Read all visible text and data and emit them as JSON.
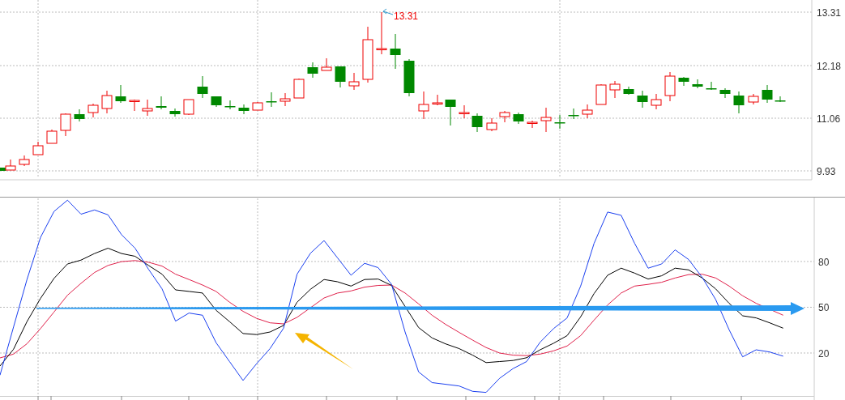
{
  "price_panel": {
    "axis_labels": [
      "13.31",
      "12.18",
      "11.06",
      "9.93"
    ],
    "high_marker": "13.31"
  },
  "indicator_panel": {
    "chart_data": {
      "type": "line",
      "ylim": [
        -10.8,
        121.9
      ],
      "grid": true,
      "yticks": [
        20,
        50,
        80
      ],
      "series": [
        {
          "color": "#e0204a",
          "values": [
            16.8,
            19.3,
            26.1,
            36,
            46.9,
            57.9,
            65.7,
            72.8,
            77.4,
            79.9,
            80.6,
            79.5,
            77,
            71.7,
            68.2,
            64.6,
            60.4,
            53.3,
            47.3,
            42.7,
            39.8,
            39.1,
            43.4,
            null,
            56.1,
            59.3,
            60.7,
            63.2,
            64.3,
            64.6,
            59.3,
            52.2,
            44.8,
            38.8,
            33.5,
            28.5,
            23.6,
            20,
            18.6,
            18.3,
            19.3,
            21.4,
            24.6,
            31.4,
            41.6,
            51.5,
            59.3,
            63.9,
            65,
            66.4,
            69.2,
            71.4,
            71.7,
            69.2,
            63.9,
            57.5,
            52.6,
            null,
            44.8
          ]
        },
        {
          "color": "#000000",
          "values": [
            11.5,
            22.5,
            40.6,
            55.8,
            68.9,
            78.4,
            80.9,
            85.2,
            88.7,
            85.2,
            83.4,
            77.4,
            71.7,
            61.4,
            60.4,
            59.3,
            48,
            40.6,
            32.8,
            32.1,
            33.8,
            38.1,
            53.3,
            61.8,
            68.2,
            66.7,
            63.9,
            68.2,
            68.5,
            64.3,
            50.5,
            36.7,
            29.9,
            26,
            22.9,
            18.6,
            13.7,
            14.4,
            15.1,
            16.9,
            22.1,
            26.4,
            31.4,
            43.7,
            59,
            71,
            75.6,
            72.4,
            68.5,
            70.6,
            75.6,
            74.5,
            69.2,
            62.1,
            52.6,
            44.4,
            43,
            39.8,
            36.3
          ]
        },
        {
          "color": "#1a3ff0",
          "values": [
            5.5,
            37,
            68.2,
            95.8,
            112.8,
            120.2,
            111,
            113.8,
            110.6,
            97.6,
            88.7,
            74.9,
            62.1,
            40.9,
            46.2,
            44.8,
            26.8,
            14.4,
            2,
            13,
            22.9,
            36.3,
            71.7,
            85.5,
            93.7,
            82.3,
            71,
            78.8,
            76,
            65,
            33.8,
            7.6,
            0.6,
            -0.5,
            -1.6,
            -5.1,
            -5.8,
            3.4,
            9.8,
            14.4,
            27.1,
            36,
            43,
            63.9,
            91.9,
            112.4,
            110.3,
            91.9,
            75.6,
            78.4,
            87.6,
            81.3,
            69.6,
            55.1,
            35.2,
            17.5,
            22.1,
            20.7,
            17.9
          ]
        }
      ]
    }
  }
}
